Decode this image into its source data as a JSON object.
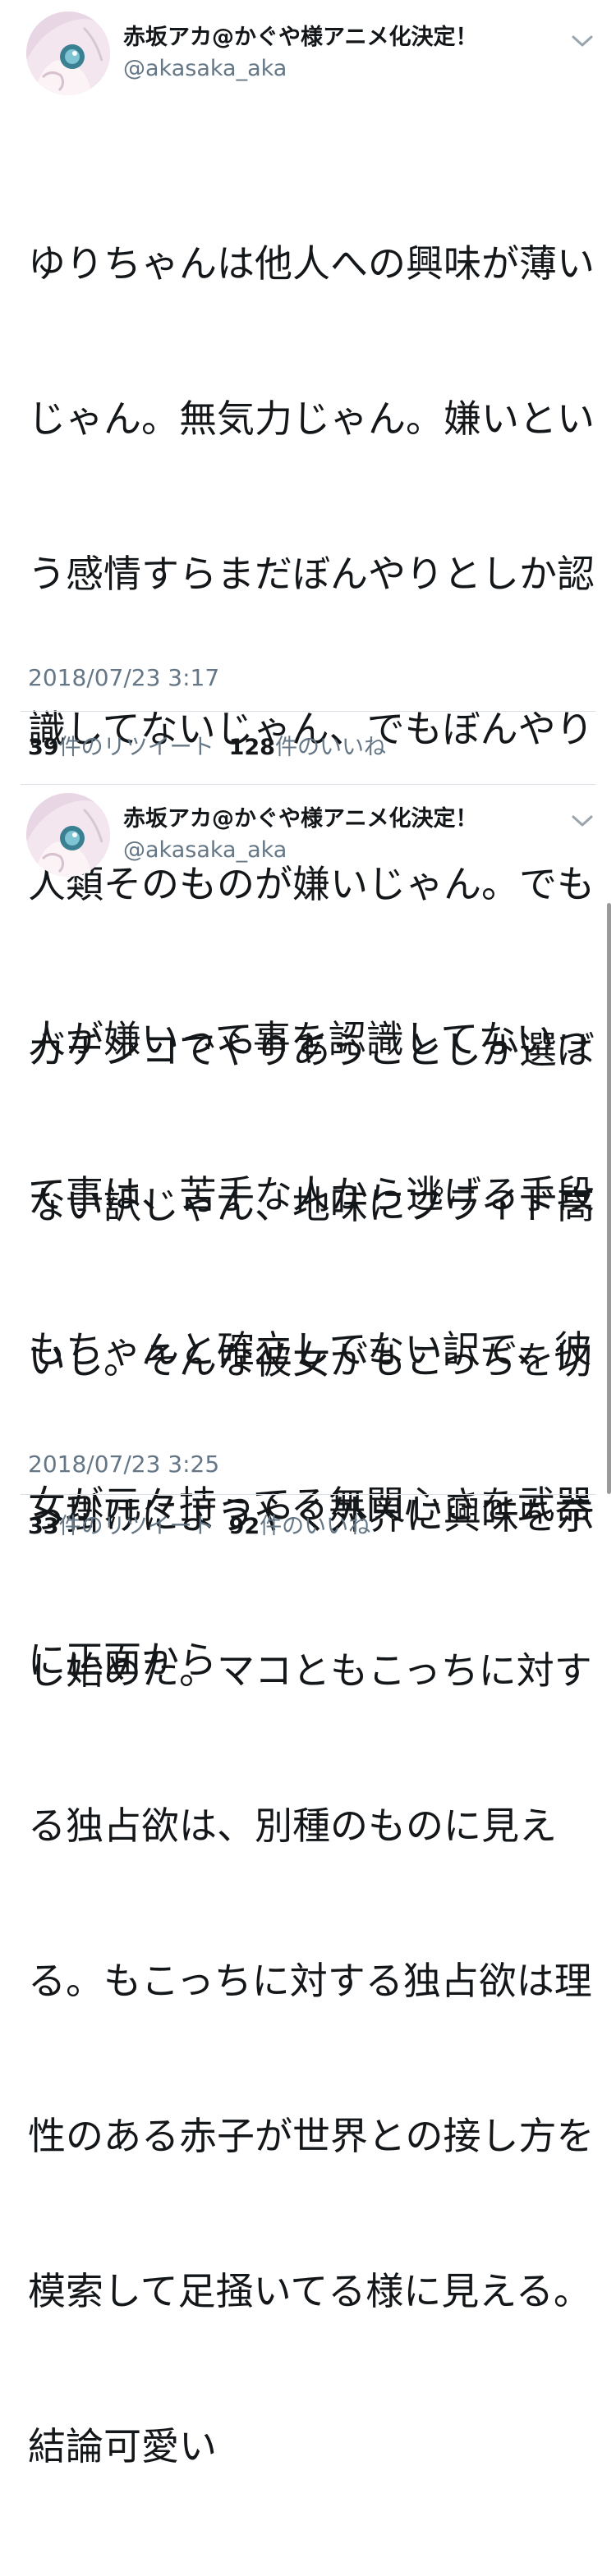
{
  "tweets": [
    {
      "display_name": "赤坂アカ@かぐや様アニメ化決定！",
      "handle": "@akasaka_aka",
      "avatar_icon": "profile-avatar",
      "caret_icon": "chevron-down-icon",
      "lines": [
        "ゆりちゃんは他人への興味が薄い",
        "じゃん。無気力じゃん。嫌いとい",
        "う感情すらまだぼんやりとしか認",
        "識してないじゃん、でもぼんやり",
        "人類そのものが嫌いじゃん。でも",
        "人が嫌いって事を認識してないっ",
        "て事は、苦手な人から逃げる手段",
        "もちゃんと確立してない訳で、彼",
        "女が元々持ってる無関心さを武器",
        "に正面から"
      ],
      "timestamp": "2018/07/23 3:17",
      "retweet_count": "39",
      "retweet_label": "件のリツイート",
      "like_count": "128",
      "like_label": "件のいいね"
    },
    {
      "display_name": "赤坂アカ@かぐや様アニメ化決定！",
      "handle": "@akasaka_aka",
      "avatar_icon": "profile-avatar",
      "caret_icon": "chevron-down-icon",
      "lines": [
        "ガチンコでやりあうことしか選ば",
        "ない訳じゃん、地味にプライド高",
        "いし。そんな彼女がもこっちを切",
        "っ掛けにようやく外界に興味を示",
        "し始めた。マコともこっちに対す",
        "る独占欲は、別種のものに見え",
        "る。もこっちに対する独占欲は理",
        "性のある赤子が世界との接し方を",
        "模索して足掻いてる様に見える。",
        "結論可愛い"
      ],
      "timestamp": "2018/07/23 3:25",
      "retweet_count": "33",
      "retweet_label": "件のリツイート",
      "like_count": "92",
      "like_label": "件のいいね"
    }
  ]
}
